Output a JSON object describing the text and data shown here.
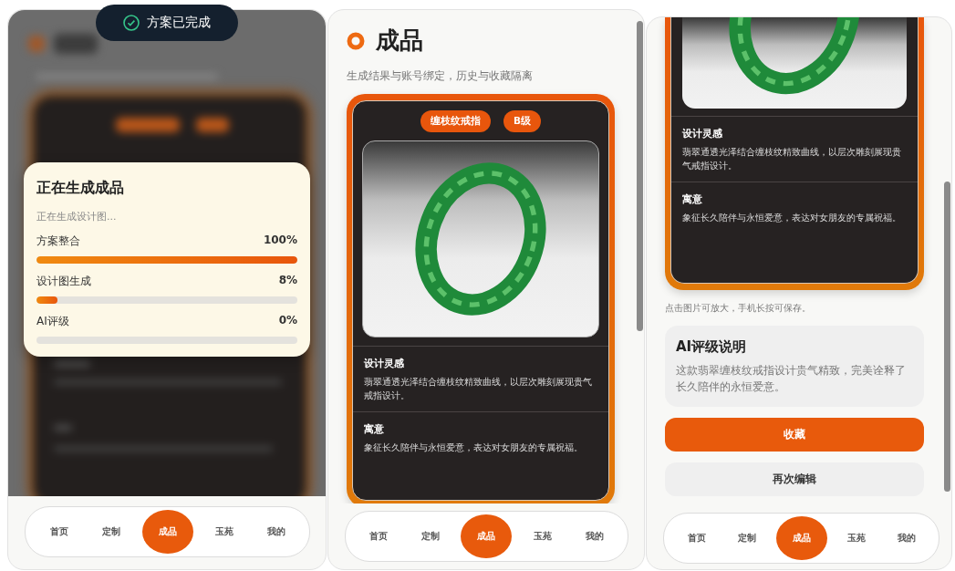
{
  "loading_screen": {
    "toast": {
      "text": "方案已完成"
    },
    "dialog": {
      "title": "正在生成成品",
      "subtitle": "正在生成设计图...",
      "steps": [
        {
          "label": "方案整合",
          "reading": "100%",
          "level": 1
        },
        {
          "label": "设计图生成",
          "reading": "8%",
          "level": 0.08
        },
        {
          "label": "AI评级",
          "reading": "0%",
          "level": 0
        }
      ]
    },
    "nav": [
      {
        "label": "首页",
        "selected": false
      },
      {
        "label": "定制",
        "selected": false
      },
      {
        "label": "成品",
        "selected": true
      },
      {
        "label": "玉苑",
        "selected": false
      },
      {
        "label": "我的",
        "selected": false
      }
    ]
  },
  "result_screen": {
    "title": "成品",
    "subtitle": "生成结果与账号绑定，历史与收藏隔离",
    "tags": [
      "缠枝纹戒指",
      "B级"
    ],
    "sections": [
      {
        "heading": "设计灵感",
        "text": "翡翠通透光泽结合缠枝纹精致曲线，以层次雕刻展现贵气戒指设计。"
      },
      {
        "heading": "寓意",
        "text": "象征长久陪伴与永恒爱意，表达对女朋友的专属祝福。"
      }
    ],
    "nav": [
      {
        "label": "首页",
        "selected": false
      },
      {
        "label": "定制",
        "selected": false
      },
      {
        "label": "成品",
        "selected": true
      },
      {
        "label": "玉苑",
        "selected": false
      },
      {
        "label": "我的",
        "selected": false
      }
    ]
  },
  "result_screen_scrolled": {
    "sections": [
      {
        "heading": "设计灵感",
        "text": "翡翠通透光泽结合缠枝纹精致曲线，以层次雕刻展现贵气戒指设计。"
      },
      {
        "heading": "寓意",
        "text": "象征长久陪伴与永恒爱意，表达对女朋友的专属祝福。"
      }
    ],
    "hint": "点击图片可放大，手机长按可保存。",
    "rating": {
      "title": "AI评级说明",
      "text": "这款翡翠缠枝纹戒指设计贵气精致，完美诠释了长久陪伴的永恒爱意。"
    },
    "buttons": [
      {
        "label": "收藏",
        "kind": "primary"
      },
      {
        "label": "再次编辑",
        "kind": "secondary"
      }
    ],
    "nav": [
      {
        "label": "首页",
        "selected": false
      },
      {
        "label": "定制",
        "selected": false
      },
      {
        "label": "成品",
        "selected": true
      },
      {
        "label": "玉苑",
        "selected": false
      },
      {
        "label": "我的",
        "selected": false
      }
    ]
  }
}
